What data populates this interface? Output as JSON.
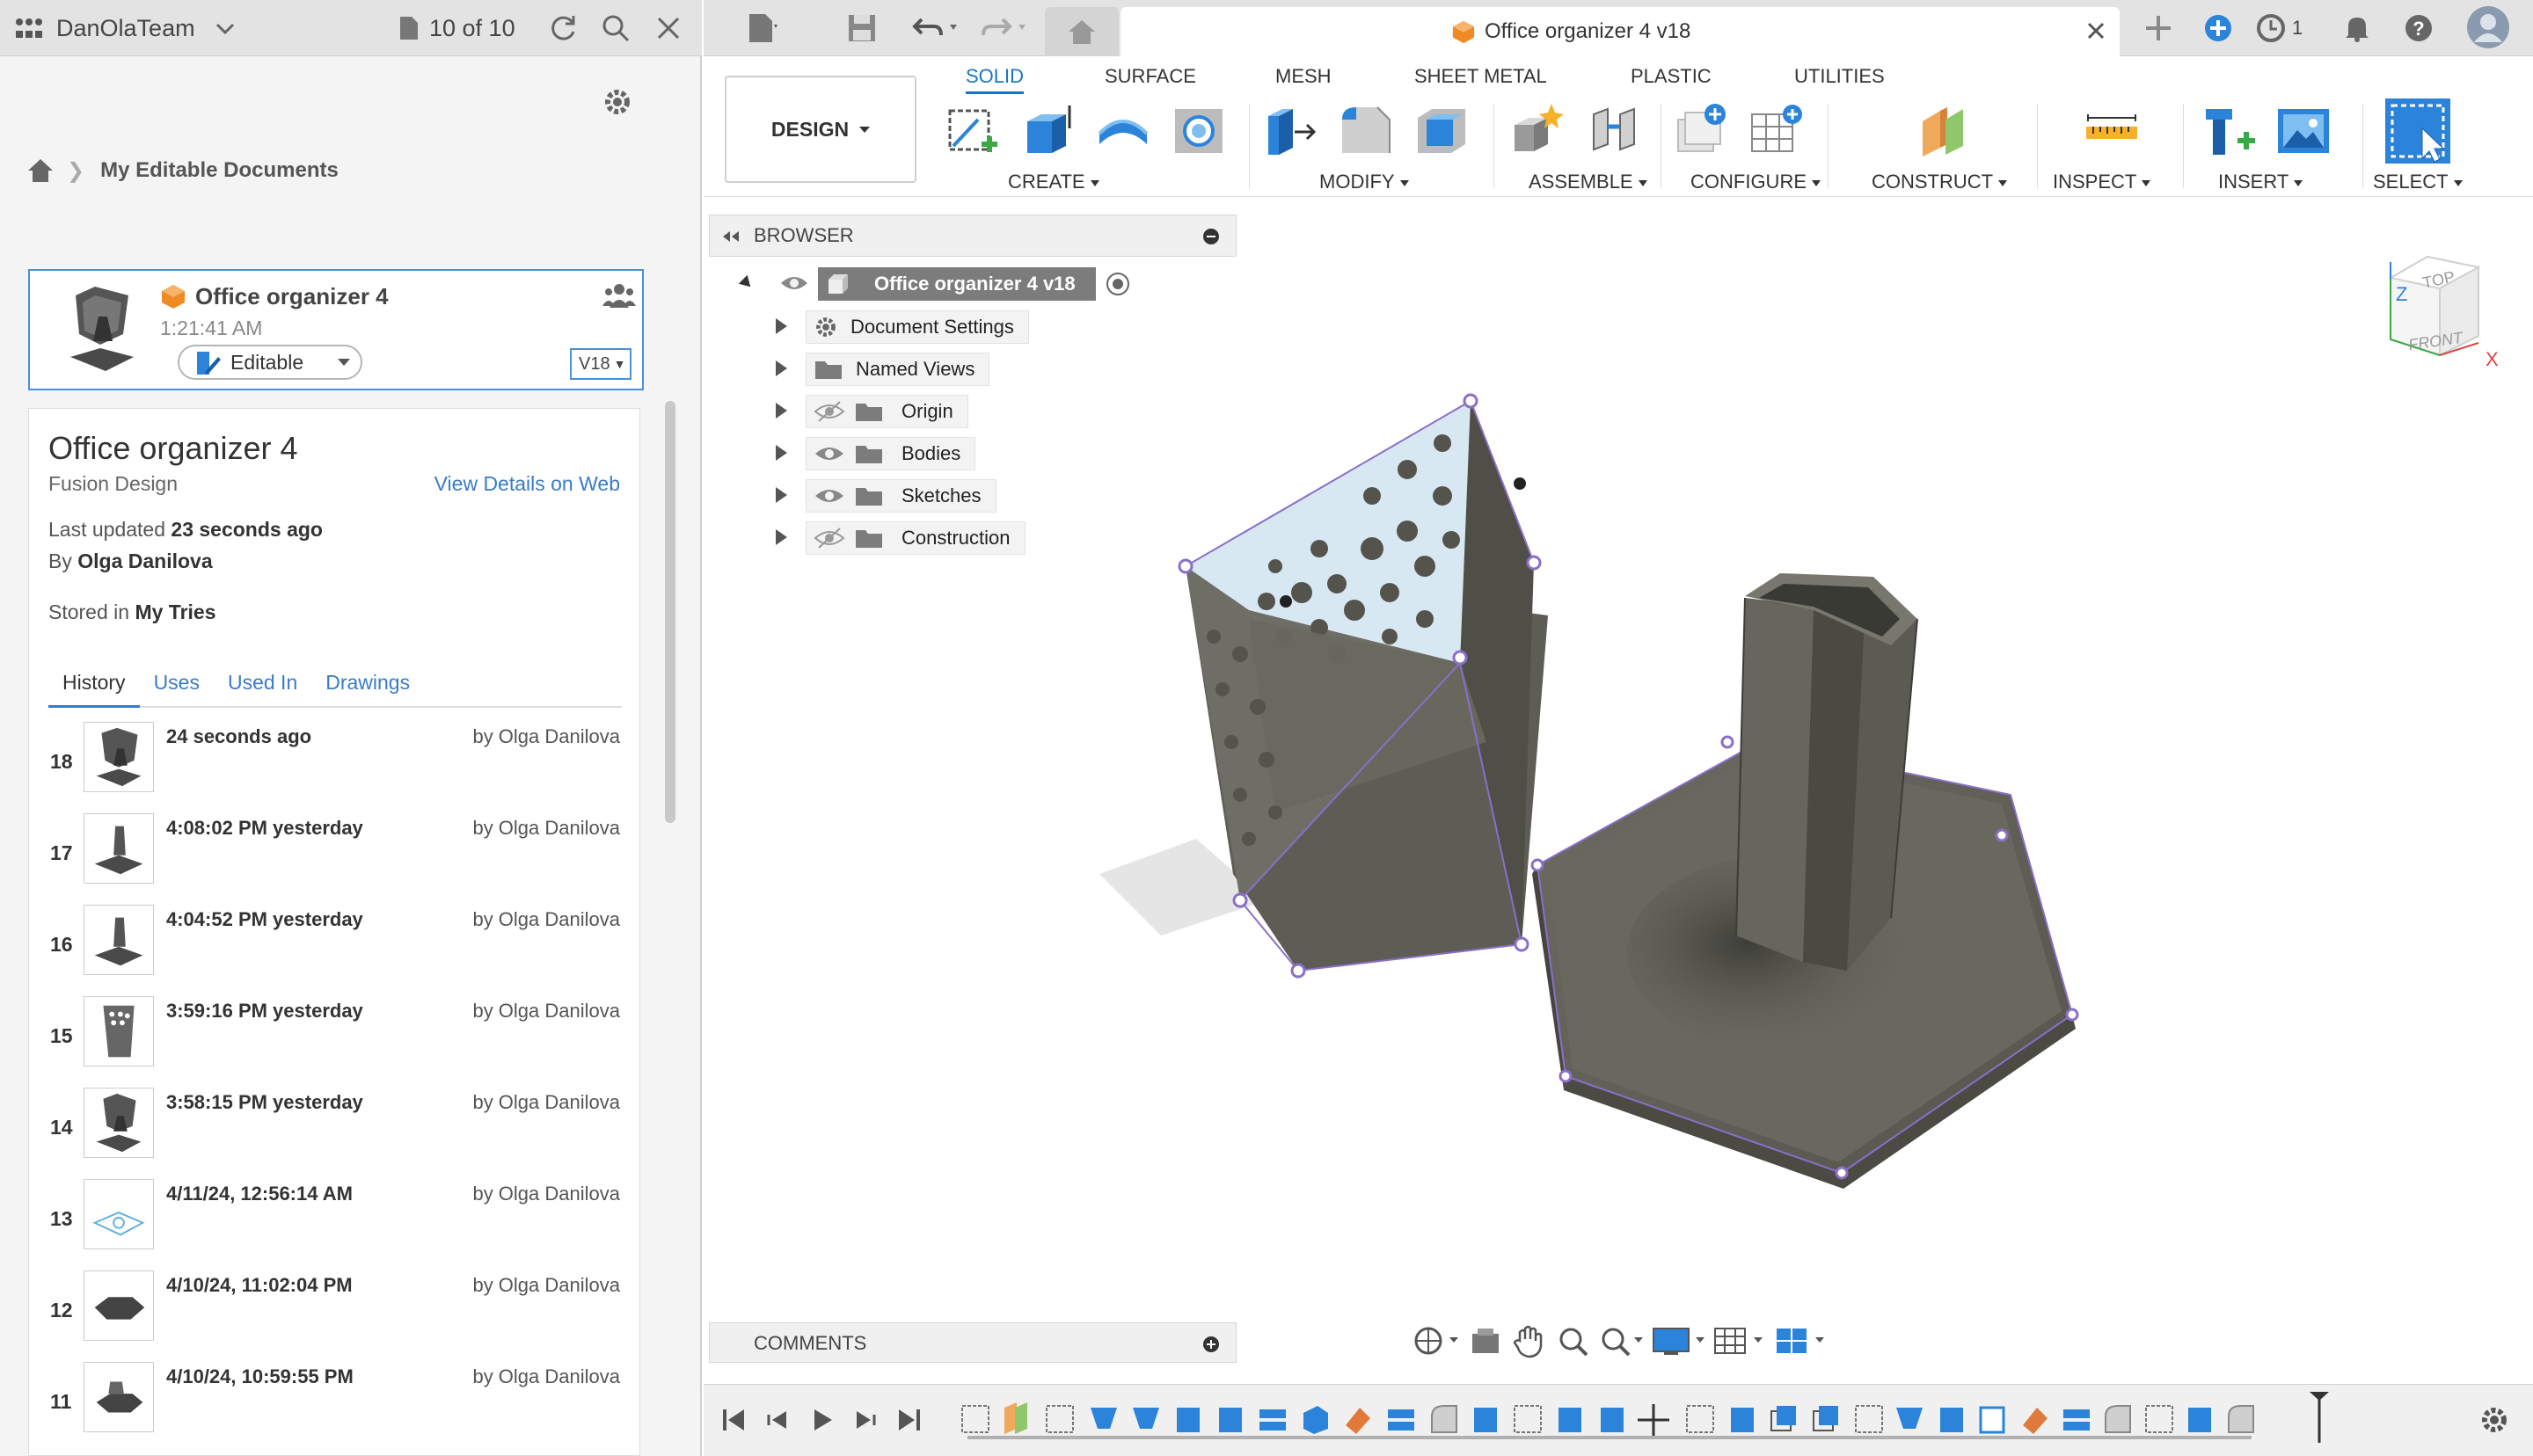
{
  "left_topbar": {
    "team_name": "DanOlaTeam",
    "doc_count": "10 of 10"
  },
  "breadcrumb": {
    "label": "My Editable Documents"
  },
  "doc_card": {
    "title": "Office organizer 4",
    "time": "1:21:41 AM",
    "status": "Editable",
    "version": "V18"
  },
  "details": {
    "title": "Office organizer 4",
    "subtitle": "Fusion Design",
    "view_web": "View Details on Web",
    "last_updated_label": "Last updated",
    "last_updated_value": "23 seconds ago",
    "by_label": "By",
    "by_value": "Olga Danilova",
    "stored_label": "Stored in",
    "stored_value": "My Tries",
    "tabs": [
      "History",
      "Uses",
      "Used In",
      "Drawings"
    ],
    "history": [
      {
        "num": "18",
        "time": "24 seconds ago",
        "by": "by Olga Danilova"
      },
      {
        "num": "17",
        "time": "4:08:02 PM yesterday",
        "by": "by Olga Danilova"
      },
      {
        "num": "16",
        "time": "4:04:52 PM yesterday",
        "by": "by Olga Danilova"
      },
      {
        "num": "15",
        "time": "3:59:16 PM yesterday",
        "by": "by Olga Danilova"
      },
      {
        "num": "14",
        "time": "3:58:15 PM yesterday",
        "by": "by Olga Danilova"
      },
      {
        "num": "13",
        "time": "4/11/24, 12:56:14 AM",
        "by": "by Olga Danilova"
      },
      {
        "num": "12",
        "time": "4/10/24, 11:02:04 PM",
        "by": "by Olga Danilova"
      },
      {
        "num": "11",
        "time": "4/10/24, 10:59:55 PM",
        "by": "by Olga Danilova"
      }
    ]
  },
  "window": {
    "doc_tab_title": "Office organizer 4 v18",
    "notifications_count": "1"
  },
  "toolbar": {
    "design_label": "DESIGN",
    "workspaces": [
      "SOLID",
      "SURFACE",
      "MESH",
      "SHEET METAL",
      "PLASTIC",
      "UTILITIES"
    ],
    "groups": [
      "CREATE",
      "MODIFY",
      "ASSEMBLE",
      "CONFIGURE",
      "CONSTRUCT",
      "INSPECT",
      "INSERT",
      "SELECT"
    ]
  },
  "browser": {
    "title": "BROWSER",
    "root": "Office organizer 4 v18",
    "nodes": [
      "Document Settings",
      "Named Views",
      "Origin",
      "Bodies",
      "Sketches",
      "Construction"
    ]
  },
  "comments": {
    "title": "COMMENTS"
  },
  "viewcube": {
    "top": "TOP",
    "front": "FRONT",
    "x": "X",
    "z": "Z"
  },
  "colors": {
    "accent": "#1a73c8",
    "model_dark": "#5a5a52",
    "sketch_purple": "#8a6fc8"
  }
}
